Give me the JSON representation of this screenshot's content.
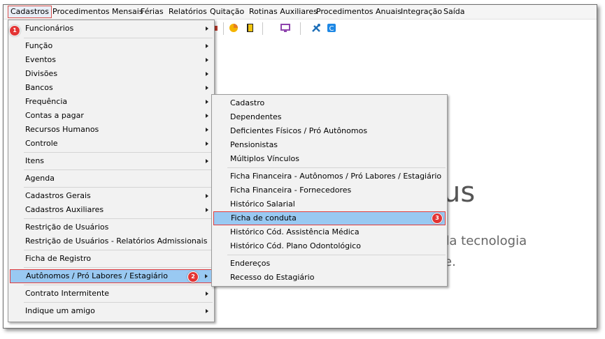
{
  "menubar": {
    "items": [
      "Cadastros",
      "Procedimentos Mensais",
      "Férias",
      "Relatórios",
      "Quitação",
      "Rotinas Auxiliares",
      "Procedimentos Anuais",
      "Integração",
      "Saída"
    ]
  },
  "background": {
    "large_text": "us",
    "line1": "da tecnologia",
    "line2": "e."
  },
  "toolbar": {
    "icons": [
      "printer-icon",
      "chart-icon",
      "book-icon",
      "monitor-icon",
      "tools-icon",
      "c-icon"
    ]
  },
  "cadastros_menu": {
    "items": [
      {
        "label": "Funcionários",
        "submenu": true
      },
      {
        "label": "Função",
        "submenu": true
      },
      {
        "label": "Eventos",
        "submenu": true
      },
      {
        "label": "Divisões",
        "submenu": true
      },
      {
        "label": "Bancos",
        "submenu": true
      },
      {
        "label": "Frequência",
        "submenu": true
      },
      {
        "label": "Contas a pagar",
        "submenu": true
      },
      {
        "label": "Recursos Humanos",
        "submenu": true
      },
      {
        "label": "Controle",
        "submenu": true
      },
      {
        "label": "Itens",
        "submenu": true
      },
      {
        "label": "Agenda",
        "submenu": false
      },
      {
        "label": "Cadastros Gerais",
        "submenu": true
      },
      {
        "label": "Cadastros Auxiliares",
        "submenu": true
      },
      {
        "label": "Restrição de Usuários",
        "submenu": false
      },
      {
        "label": "Restrição de Usuários - Relatórios Admissionais",
        "submenu": false
      },
      {
        "label": "Ficha de Registro",
        "submenu": false
      },
      {
        "label": "Autônomos / Pró Labores / Estagiário",
        "submenu": true
      },
      {
        "label": "Contrato Intermitente",
        "submenu": true
      },
      {
        "label": "Indique um amigo",
        "submenu": true
      }
    ]
  },
  "autonomos_submenu": {
    "items": [
      "Cadastro",
      "Dependentes",
      "Deficientes Físicos / Pró Autônomos",
      "Pensionistas",
      "Múltiplos Vínculos",
      "Ficha Financeira - Autônomos / Pró Labores / Estagiário",
      "Ficha Financeira - Fornecedores",
      "Histórico Salarial",
      "Ficha de conduta",
      "Histórico Cód. Assistência Médica",
      "Histórico Cód. Plano Odontológico",
      "Endereços",
      "Recesso do Estagiário"
    ]
  },
  "badges": [
    "1",
    "2",
    "3"
  ],
  "colors": {
    "highlight": "#99c9f2",
    "badge": "#e33434",
    "outline": "#e23b3b"
  }
}
